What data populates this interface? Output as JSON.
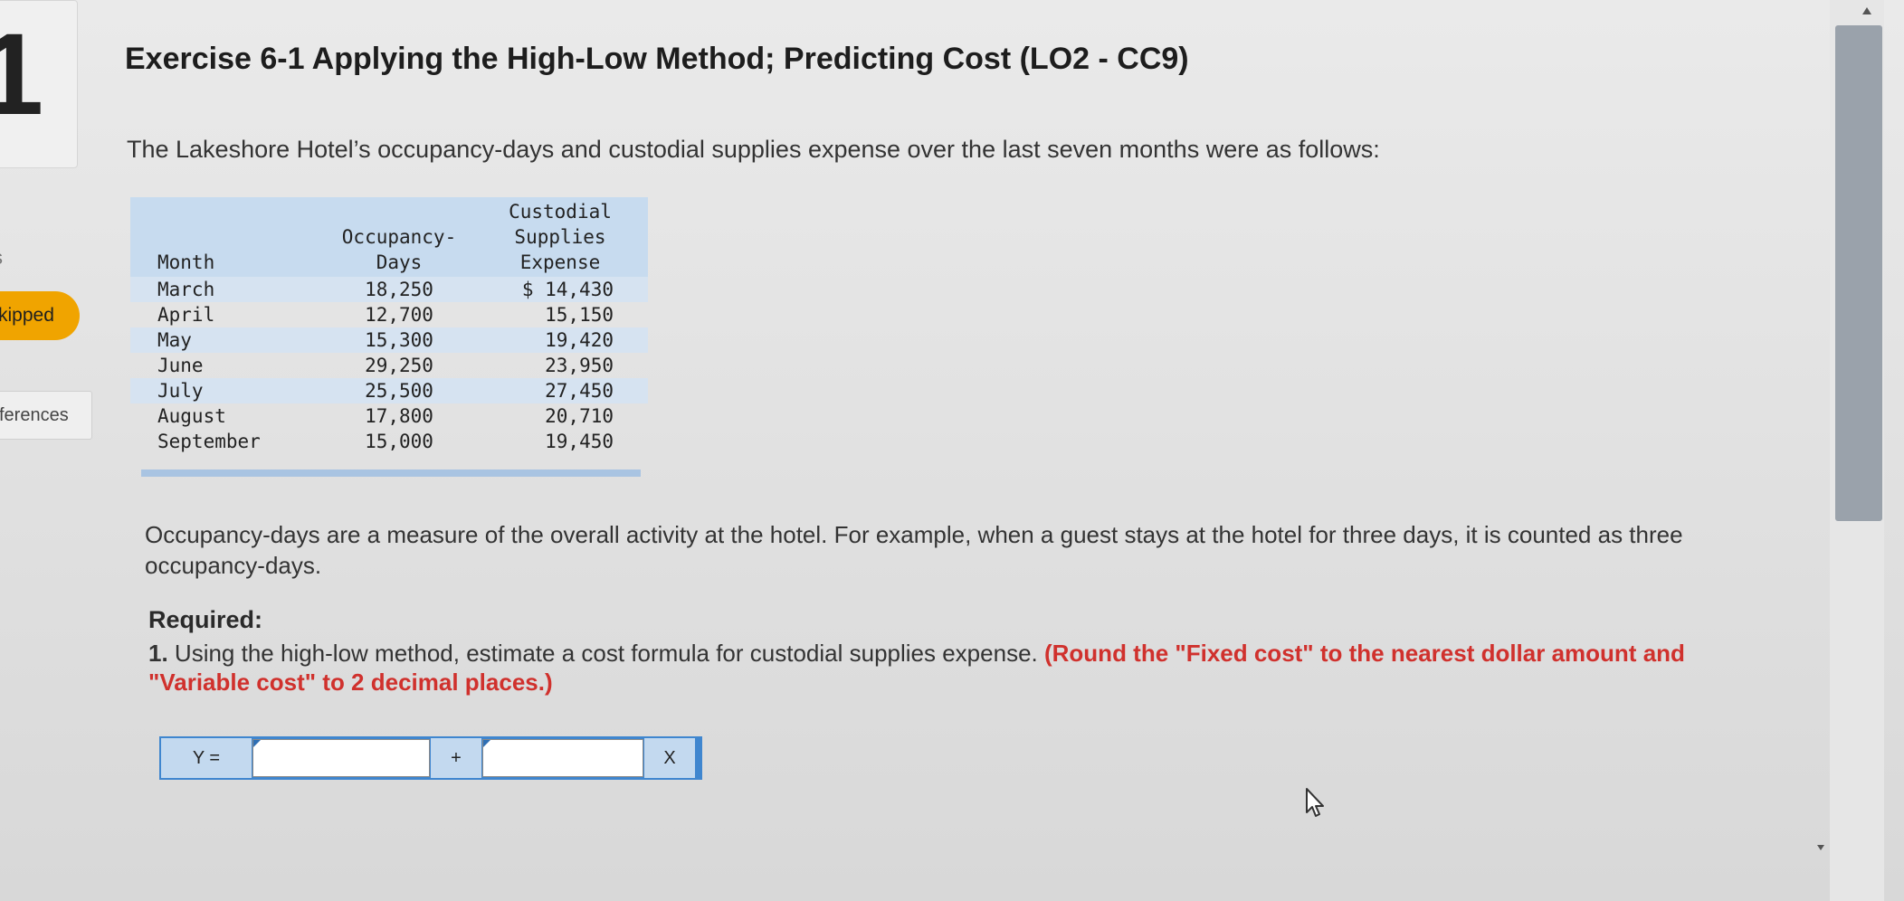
{
  "sidebar": {
    "question_number": "1",
    "points_fragment": "s",
    "status_label": "kipped",
    "references_label": "ferences"
  },
  "exercise": {
    "title": "Exercise 6-1 Applying the High-Low Method; Predicting Cost (LO2 - CC9)",
    "intro": "The Lakeshore Hotel’s occupancy-days and custodial supplies expense over the last seven months were as follows:",
    "table": {
      "headers": {
        "month": "Month",
        "occupancy": "Occupancy-\nDays",
        "expense": "Custodial\nSupplies\nExpense"
      },
      "rows": [
        {
          "month": "March",
          "occupancy": "18,250",
          "expense": "$ 14,430"
        },
        {
          "month": "April",
          "occupancy": "12,700",
          "expense": "15,150"
        },
        {
          "month": "May",
          "occupancy": "15,300",
          "expense": "19,420"
        },
        {
          "month": "June",
          "occupancy": "29,250",
          "expense": "23,950"
        },
        {
          "month": "July",
          "occupancy": "25,500",
          "expense": "27,450"
        },
        {
          "month": "August",
          "occupancy": "17,800",
          "expense": "20,710"
        },
        {
          "month": "September",
          "occupancy": "15,000",
          "expense": "19,450"
        }
      ]
    },
    "paragraph": "Occupancy-days are a measure of the overall activity at the hotel. For example, when a guest stays at the hotel for three days, it is counted as three occupancy-days.",
    "required_heading": "Required:",
    "required_number": "1.",
    "required_text": "Using the high-low method, estimate a cost formula for custodial supplies expense.",
    "required_instruction": "(Round the \"Fixed cost\" to the nearest dollar amount and \"Variable cost\" to 2 decimal places.)",
    "formula": {
      "y_label": "Y =",
      "plus": "+",
      "x_label": "X",
      "fixed_value": "",
      "variable_value": ""
    }
  },
  "colors": {
    "table_header": "#c7dbef",
    "table_shade": "#d6e3f1",
    "formula_bar": "#3f86cf",
    "skipped_badge": "#f0a400",
    "instruction_red": "#d0312d"
  }
}
